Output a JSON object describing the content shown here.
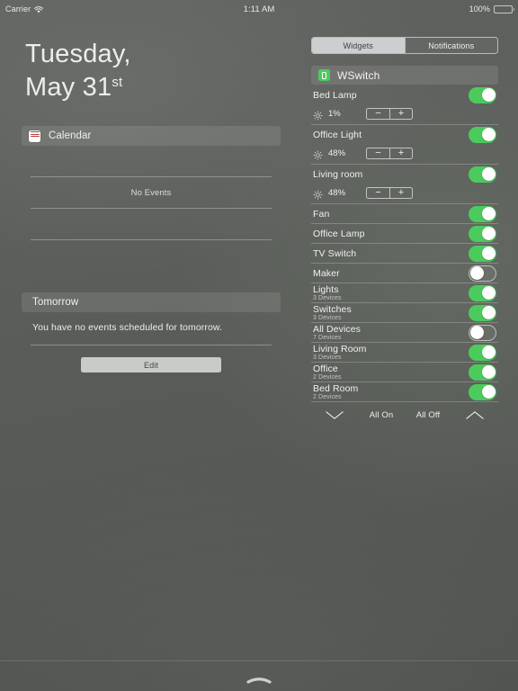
{
  "statusbar": {
    "carrier": "Carrier",
    "wifi_icon": "wifi-icon",
    "time": "1:11 AM",
    "battery_percent": "100%",
    "battery_icon": "battery-full-icon"
  },
  "left": {
    "date": {
      "weekday": "Tuesday,",
      "month_day": "May 31",
      "ordinal": "st"
    },
    "calendar_widget": {
      "icon": "calendar-icon",
      "title": "Calendar",
      "no_events_text": "No Events"
    },
    "tomorrow_widget": {
      "title": "Tomorrow",
      "body": "You have no events scheduled for tomorrow."
    },
    "edit_button": "Edit"
  },
  "right": {
    "tabs": [
      {
        "label": "Widgets",
        "selected": true
      },
      {
        "label": "Notifications",
        "selected": false
      }
    ],
    "widget": {
      "icon": "wswitch-icon",
      "title": "WSwitch"
    },
    "dimmers": [
      {
        "name": "Bed Lamp",
        "brightness": "1%",
        "brightness_icon": "brightness-icon",
        "minus": "−",
        "plus": "+",
        "on": true
      },
      {
        "name": "Office Light",
        "brightness": "48%",
        "brightness_icon": "brightness-icon",
        "minus": "−",
        "plus": "+",
        "on": true
      },
      {
        "name": "Living room",
        "brightness": "48%",
        "brightness_icon": "brightness-icon",
        "minus": "−",
        "plus": "+",
        "on": true
      }
    ],
    "switches": [
      {
        "name": "Fan",
        "on": true
      },
      {
        "name": "Office Lamp",
        "on": true
      },
      {
        "name": "TV Switch",
        "on": true
      },
      {
        "name": "Maker",
        "on": false
      }
    ],
    "groups": [
      {
        "name": "Lights",
        "devices": "3 Devices",
        "on": true
      },
      {
        "name": "Switches",
        "devices": "3 Devices",
        "on": true
      },
      {
        "name": "All Devices",
        "devices": "7 Devices",
        "on": false
      },
      {
        "name": "Living Room",
        "devices": "3 Devices",
        "on": true
      },
      {
        "name": "Office",
        "devices": "2 Devices",
        "on": true
      },
      {
        "name": "Bed Room",
        "devices": "2 Devices",
        "on": true
      }
    ],
    "footer": {
      "collapse_icon": "chevron-down-icon",
      "all_on": "All On",
      "all_off": "All Off",
      "expand_icon": "chevron-up-icon"
    }
  },
  "bottom": {
    "handle_icon": "grabber-handle-icon"
  },
  "colors": {
    "toggle_on": "#4ccb5d",
    "accent_calendar": "#c9413c",
    "text_primary": "#f0f1ef",
    "text_secondary": "#c4c6c3"
  }
}
